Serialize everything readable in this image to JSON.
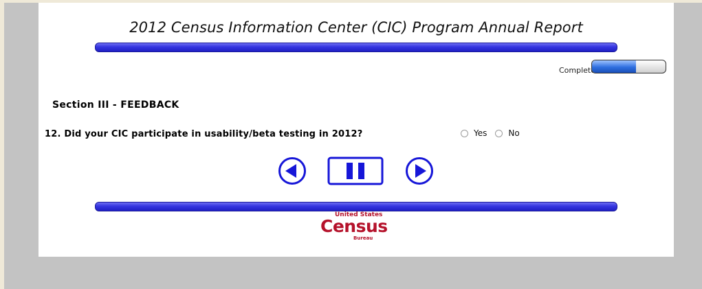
{
  "header": {
    "title": "2012 Census Information Center (CIC) Program Annual Report"
  },
  "progress": {
    "label": "Completed",
    "fraction": 0.6
  },
  "section": {
    "title": "Section III - FEEDBACK"
  },
  "question": {
    "text": "12. Did your CIC participate in usability/beta testing in 2012?",
    "options": [
      "Yes",
      "No"
    ]
  },
  "nav": {
    "back_icon": "back-arrow-icon",
    "pause_icon": "pause-icon",
    "next_icon": "next-arrow-icon"
  },
  "logo": {
    "top": "United States",
    "main": "Census",
    "bottom": "Bureau"
  },
  "colors": {
    "bar": "#3535e0",
    "nav": "#1616d8",
    "logo": "#b5122b",
    "background": "#c3c3c3"
  }
}
